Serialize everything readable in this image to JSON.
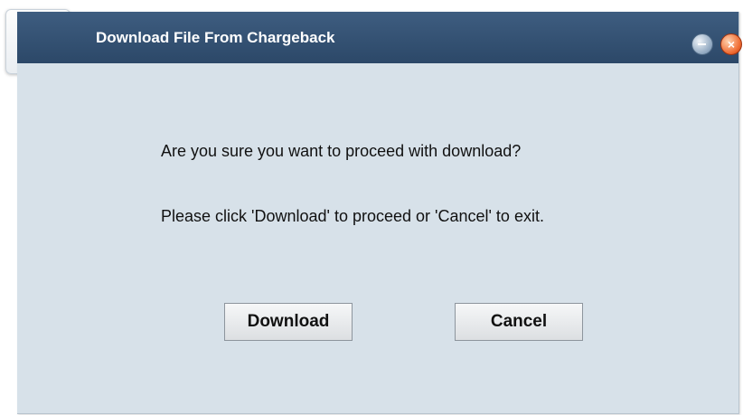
{
  "window": {
    "title": "Download File From Chargeback",
    "app_icon": "app-tiles-icon",
    "controls": {
      "minimize_icon": "minimize-icon",
      "close_icon": "close-icon",
      "close_glyph": "×"
    }
  },
  "message": {
    "question": "Are you sure you want to proceed with download?",
    "instruction": "Please click 'Download' to proceed or 'Cancel' to exit."
  },
  "buttons": {
    "download_label": "Download",
    "cancel_label": "Cancel"
  },
  "colors": {
    "titlebar": "#34506f",
    "dialog_background": "#d7e1e9",
    "close_button": "#ef6b32"
  }
}
